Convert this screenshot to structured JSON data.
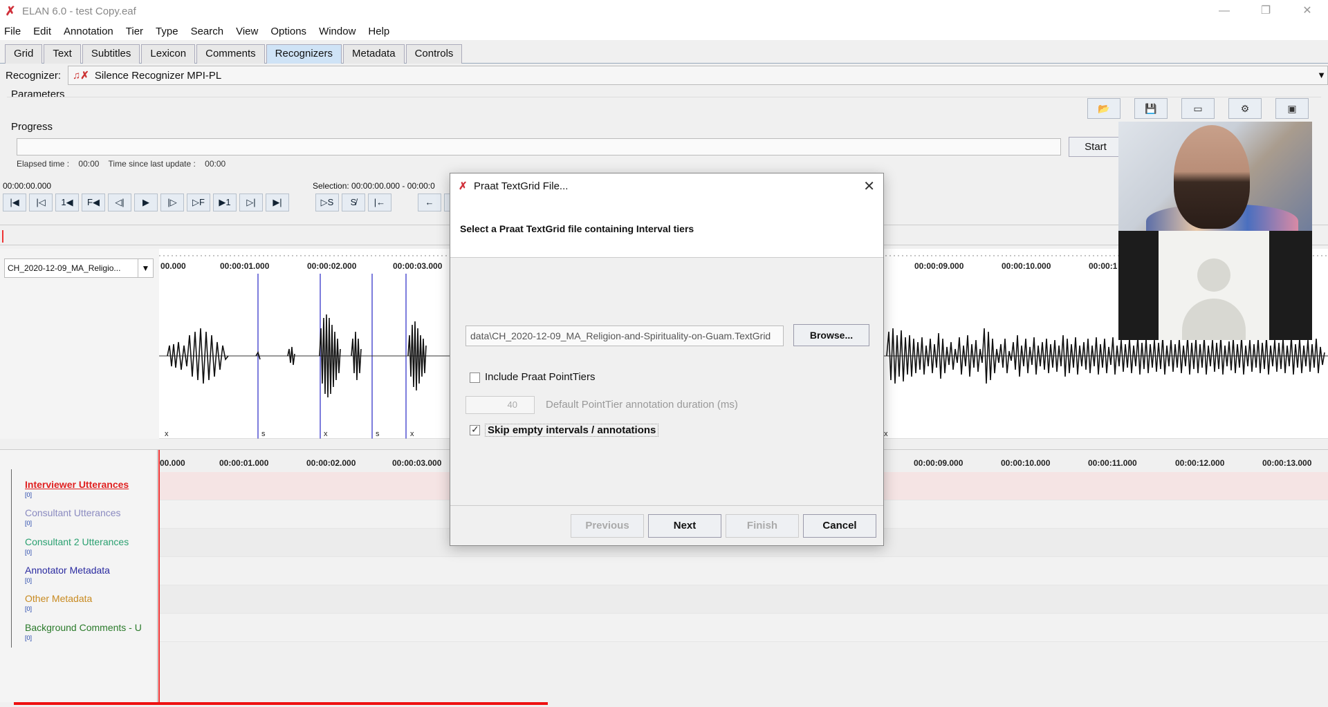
{
  "window": {
    "title": "ELAN 6.0 - test Copy.eaf",
    "controls": [
      "—",
      "❐",
      "✕"
    ]
  },
  "menu": [
    "File",
    "Edit",
    "Annotation",
    "Tier",
    "Type",
    "Search",
    "View",
    "Options",
    "Window",
    "Help"
  ],
  "tabs": [
    "Grid",
    "Text",
    "Subtitles",
    "Lexicon",
    "Comments",
    "Recognizers",
    "Metadata",
    "Controls"
  ],
  "active_tab": "Recognizers",
  "recognizer": {
    "label": "Recognizer:",
    "value": "Silence Recognizer MPI-PL"
  },
  "parameters_label": "Parameters",
  "progress": {
    "label": "Progress",
    "start_label": "Start",
    "elapsed_label": "Elapsed time :",
    "elapsed_value": "00:00",
    "since_label": "Time since last update :",
    "since_value": "00:00"
  },
  "media": {
    "current_time": "00:00:00.000",
    "selection": "Selection: 00:00:00.000 - 00:00:0",
    "file": "CH_2020-12-09_MA_Religio..."
  },
  "ruler_ticks_top": [
    "00.000",
    "00:00:01.000",
    "00:00:02.000",
    "00:00:03.000",
    "00:00:09.000",
    "00:00:10.000",
    "00:00:1"
  ],
  "ruler_ticks_bottom": [
    "00.000",
    "00:00:01.000",
    "00:00:02.000",
    "00:00:03.000",
    "00:00:09.000",
    "00:00:10.000",
    "00:00:11.000",
    "00:00:12.000",
    "00:00:13.000"
  ],
  "annotation_marks": [
    "x",
    "s",
    "x",
    "s",
    "x",
    "x"
  ],
  "tiers": [
    {
      "name": "Interviewer Utterances",
      "count": "[0]",
      "color": "#e02020"
    },
    {
      "name": "Consultant Utterances",
      "count": "[0]",
      "color": "#8a8ac0"
    },
    {
      "name": "Consultant 2 Utterances",
      "count": "[0]",
      "color": "#2aa070"
    },
    {
      "name": "Annotator Metadata",
      "count": "[0]",
      "color": "#2a2aa0"
    },
    {
      "name": "Other Metadata",
      "count": "[0]",
      "color": "#c88a20"
    },
    {
      "name": "Background Comments - U",
      "count": "[0]",
      "color": "#2a7a2a"
    }
  ],
  "dialog": {
    "title": "Praat TextGrid File...",
    "instruction": "Select a Praat TextGrid file containing Interval tiers",
    "file_path": "data\\CH_2020-12-09_MA_Religion-and-Spirituality-on-Guam.TextGrid",
    "browse_label": "Browse...",
    "include_point_tiers_label": "Include Praat PointTiers",
    "include_point_tiers_checked": false,
    "duration_value": "40",
    "duration_label": "Default PointTier annotation duration (ms)",
    "skip_empty_label": "Skip empty intervals / annotations",
    "skip_empty_checked": true,
    "buttons": {
      "previous": "Previous",
      "next": "Next",
      "finish": "Finish",
      "cancel": "Cancel"
    }
  }
}
